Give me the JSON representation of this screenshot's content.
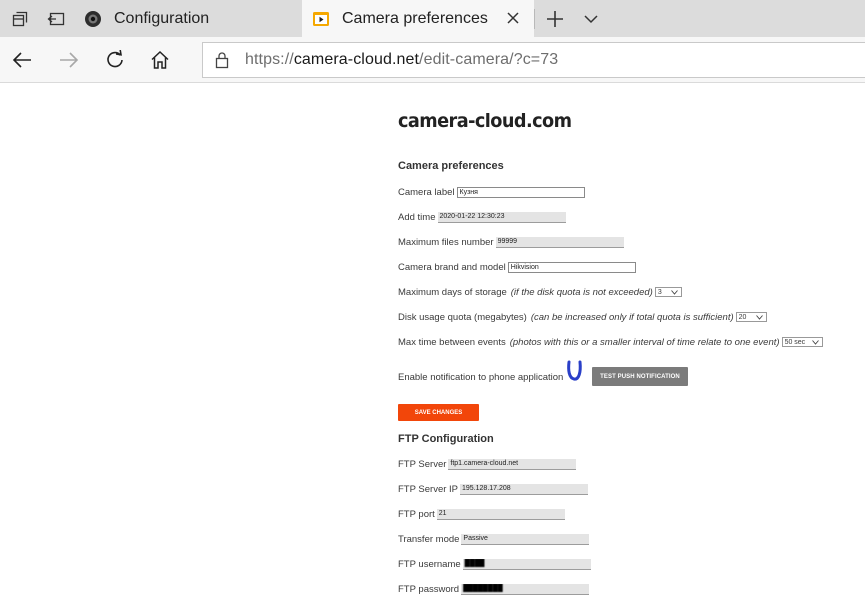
{
  "browser": {
    "tabs": [
      {
        "title": "Configuration",
        "active": false
      },
      {
        "title": "Camera preferences",
        "active": true
      }
    ],
    "url": {
      "scheme": "https://",
      "host": "camera-cloud.net",
      "path": "/edit-camera/?c=73"
    },
    "icons": {
      "tab_actions": "tab-actions-icon",
      "set_aside": "set-aside-tabs-icon",
      "back": "back-arrow-icon",
      "forward": "forward-arrow-icon",
      "refresh": "refresh-icon",
      "home": "home-icon",
      "lock": "lock-icon",
      "new_tab": "plus-icon",
      "tab_list": "chevron-down-icon",
      "close_tab": "close-icon"
    }
  },
  "page": {
    "brand": "camera-cloud.com",
    "camera_section_title": "Camera preferences",
    "fields": {
      "camera_label": {
        "label": "Camera label",
        "value": "Кузня"
      },
      "add_time": {
        "label": "Add time",
        "value": "2020-01-22 12:30:23"
      },
      "max_files": {
        "label": "Maximum files number",
        "value": "99999"
      },
      "brand_model": {
        "label": "Camera brand and model",
        "value": "Hikvision"
      },
      "max_days": {
        "label": "Maximum days of storage",
        "hint": "(if the disk quota is not exceeded)",
        "value": "3"
      },
      "disk_quota": {
        "label": "Disk usage quota (megabytes)",
        "hint": "(can be increased only if total quota is sufficient)",
        "value": "20"
      },
      "max_time": {
        "label": "Max time between events",
        "hint": "(photos with this or a smaller interval of time relate to one event)",
        "value": "50 sec"
      },
      "notification": {
        "label": "Enable notification to phone application"
      }
    },
    "test_push_button": "TEST PUSH NOTIFICATION",
    "save_button": "SAVE CHANGES",
    "ftp_section_title": "FTP Configuration",
    "ftp": {
      "server": {
        "label": "FTP Server",
        "value": "ftp1.camera-cloud.net"
      },
      "server_ip": {
        "label": "FTP Server IP",
        "value": "195.128.17.208"
      },
      "port": {
        "label": "FTP port",
        "value": "21"
      },
      "transfer_mode": {
        "label": "Transfer mode",
        "value": "Passive"
      },
      "username": {
        "label": "FTP username"
      },
      "password": {
        "label": "FTP password"
      }
    }
  },
  "colors": {
    "save_button": "#f2460a",
    "test_button": "#7b7b7b",
    "tab_active": "#f7f7f7",
    "tab_strip": "#dcdcdc",
    "annotation_mark": "#2a3fc8"
  }
}
